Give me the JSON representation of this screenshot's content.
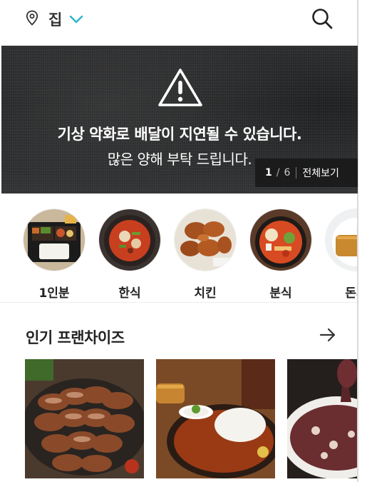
{
  "header": {
    "location_label": "집",
    "icons": [
      "location-pin-icon",
      "chevron-down-icon",
      "search-icon"
    ],
    "accent_color": "#2ab6c8"
  },
  "banner": {
    "line1": "기상 악화로 배달이 지연될 수 있습니다.",
    "line2": "많은 양해 부탁 드립니다.",
    "pager_current": "1",
    "pager_separator": "/",
    "pager_total": "6",
    "view_all": "전체보기",
    "icon": "warning-icon"
  },
  "categories": [
    {
      "label": "1인분"
    },
    {
      "label": "한식"
    },
    {
      "label": "치킨"
    },
    {
      "label": "분식"
    },
    {
      "label": "돈까"
    }
  ],
  "popular": {
    "title": "인기 프랜차이즈",
    "arrow_icon": "arrow-right-icon"
  }
}
